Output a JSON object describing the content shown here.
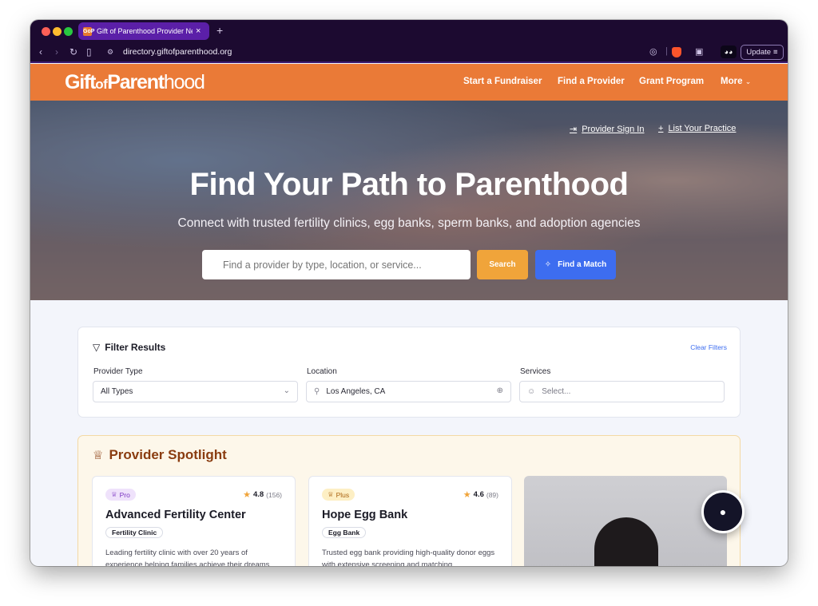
{
  "browser": {
    "tab_title": "Gift of Parenthood Provider Ne",
    "tab_favicon_text": "GoP",
    "url": "directory.giftofparenthood.org",
    "update_label": "Update"
  },
  "header": {
    "logo_gift": "Gift",
    "logo_of": "of",
    "logo_parent": "Parent",
    "logo_hood": "hood",
    "nav": [
      "Start a Fundraiser",
      "Find a Provider",
      "Grant Program",
      "More"
    ]
  },
  "hero": {
    "provider_sign_in": "Provider Sign In",
    "list_practice": "List Your Practice",
    "title": "Find Your Path to Parenthood",
    "subtitle": "Connect with trusted fertility clinics, egg banks, sperm banks, and adoption agencies",
    "search_placeholder": "Find a provider by type, location, or service...",
    "search_label": "Search",
    "match_label": "Find a Match"
  },
  "filters": {
    "title": "Filter Results",
    "clear": "Clear Filters",
    "provider_type_label": "Provider Type",
    "provider_type_value": "All Types",
    "location_label": "Location",
    "location_value": "Los Angeles, CA",
    "services_label": "Services",
    "services_placeholder": "Select..."
  },
  "spotlight": {
    "title": "Provider Spotlight",
    "cards": [
      {
        "badge": "Pro",
        "rating": "4.8",
        "count": "(156)",
        "name": "Advanced Fertility Center",
        "tag": "Fertility Clinic",
        "desc": "Leading fertility clinic with over 20 years of experience helping families achieve their dreams."
      },
      {
        "badge": "Plus",
        "rating": "4.6",
        "count": "(89)",
        "name": "Hope Egg Bank",
        "tag": "Egg Bank",
        "desc": "Trusted egg bank providing high-quality donor eggs with extensive screening and matching"
      }
    ]
  },
  "colors": {
    "header_orange": "#ea7a37",
    "search_orange": "#f0a43a",
    "match_blue": "#3d6df0",
    "spotlight_brown": "#8a3c10"
  },
  "icons": [
    "lock-icon",
    "sign-in-icon",
    "plus-icon",
    "sparkle-icon",
    "filter-icon",
    "crown-icon",
    "star-icon",
    "chat-icon",
    "map-pin-icon",
    "locate-icon"
  ]
}
